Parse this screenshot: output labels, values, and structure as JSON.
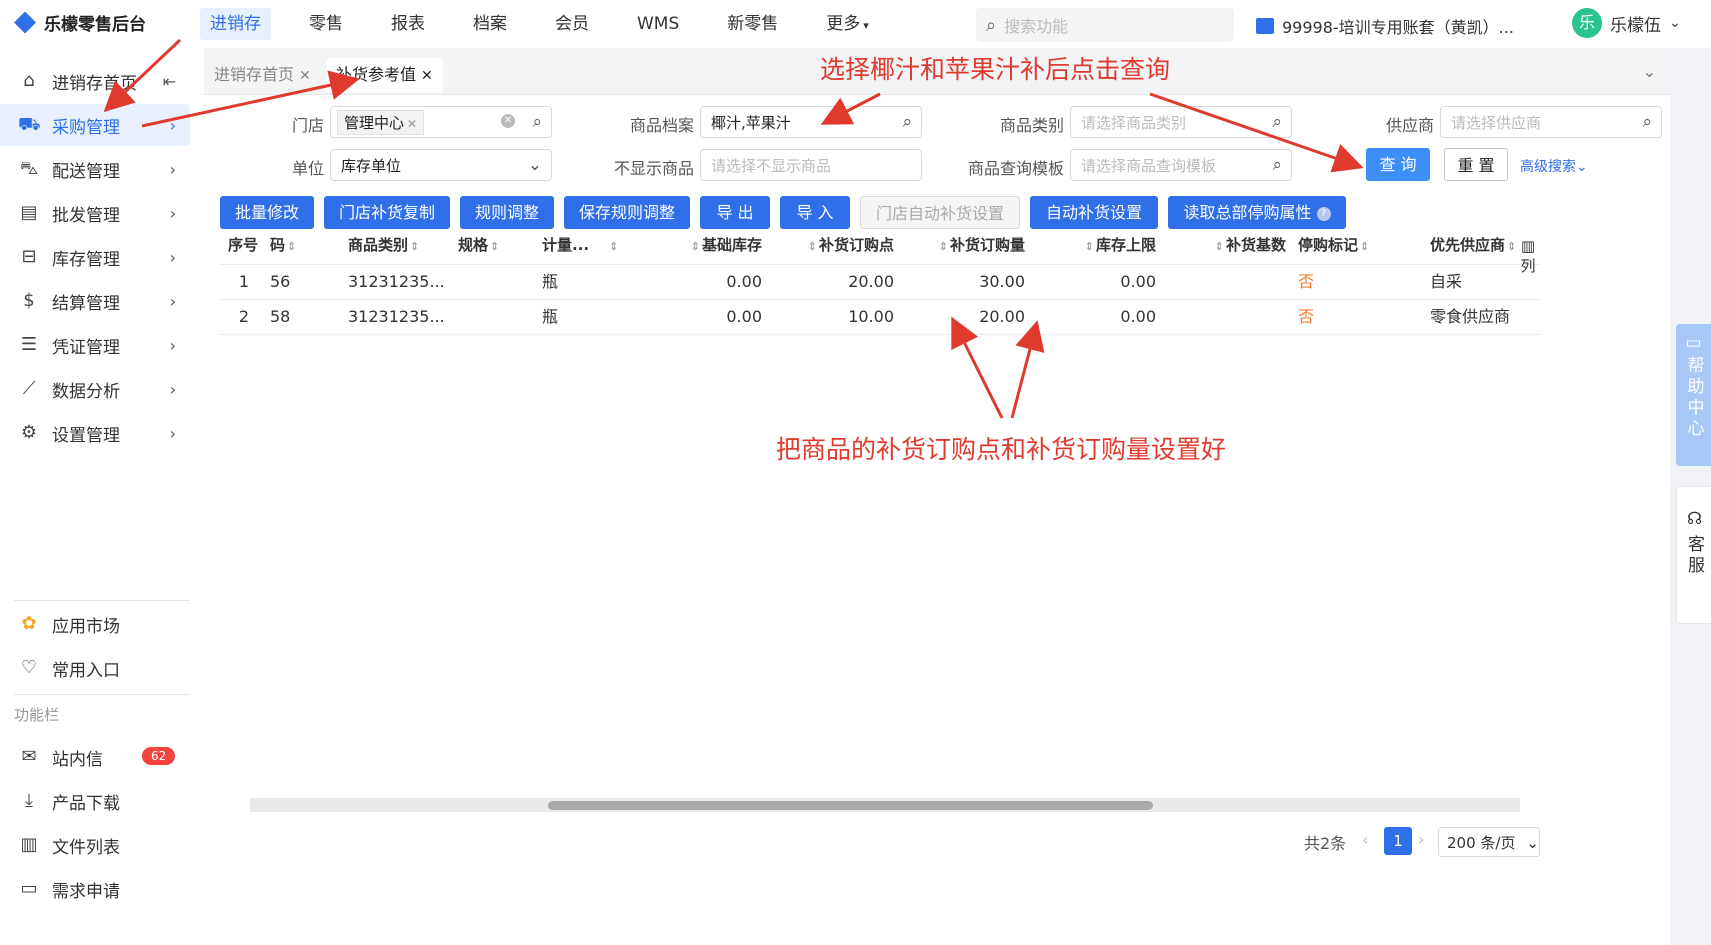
{
  "app": {
    "title": "乐檬零售后台"
  },
  "topnav": [
    "进销存",
    "零售",
    "报表",
    "档案",
    "会员",
    "WMS",
    "新零售",
    "更多"
  ],
  "search": {
    "placeholder": "搜索功能"
  },
  "account": {
    "label": "99998-培训专用账套（黄凯）..."
  },
  "user": {
    "avatar": "乐",
    "name": "乐檬伍"
  },
  "sidebar": {
    "items": [
      {
        "label": "进销存首页"
      },
      {
        "label": "采购管理"
      },
      {
        "label": "配送管理"
      },
      {
        "label": "批发管理"
      },
      {
        "label": "库存管理"
      },
      {
        "label": "结算管理"
      },
      {
        "label": "凭证管理"
      },
      {
        "label": "数据分析"
      },
      {
        "label": "设置管理"
      }
    ],
    "bottom": [
      {
        "label": "应用市场"
      },
      {
        "label": "常用入口"
      }
    ],
    "caption": "功能栏",
    "tools": [
      {
        "label": "站内信",
        "badge": "62"
      },
      {
        "label": "产品下载"
      },
      {
        "label": "文件列表"
      },
      {
        "label": "需求申请"
      }
    ]
  },
  "tabs": [
    "进销存首页",
    "补货参考值"
  ],
  "filters": {
    "store_label": "门店",
    "store_value": "管理中心",
    "goods_label": "商品档案",
    "goods_value": "椰汁,苹果汁",
    "category_label": "商品类别",
    "category_ph": "请选择商品类别",
    "supplier_label": "供应商",
    "supplier_ph": "请选择供应商",
    "unit_label": "单位",
    "unit_value": "库存单位",
    "hide_label": "不显示商品",
    "hide_ph": "请选择不显示商品",
    "template_label": "商品查询模板",
    "template_ph": "请选择商品查询模板",
    "query": "查 询",
    "reset": "重 置",
    "advanced": "高级搜索"
  },
  "toolbar": [
    "批量修改",
    "门店补货复制",
    "规则调整",
    "保存规则调整",
    "导 出",
    "导 入",
    "门店自动补货设置",
    "自动补货设置",
    "读取总部停购属性"
  ],
  "table": {
    "headers": [
      "序号",
      "码",
      "商品类别",
      "规格",
      "计量...",
      "基础库存",
      "补货订购点",
      "补货订购量",
      "库存上限",
      "补货基数",
      "停购标记",
      "优先供应商"
    ],
    "rows": [
      [
        "1",
        "56",
        "31231235...",
        "",
        "瓶",
        "0.00",
        "20.00",
        "30.00",
        "0.00",
        "",
        "否",
        "自采"
      ],
      [
        "2",
        "58",
        "31231235...",
        "",
        "瓶",
        "0.00",
        "10.00",
        "20.00",
        "0.00",
        "",
        "否",
        "零食供应商"
      ]
    ],
    "col_setting": "列"
  },
  "pagination": {
    "total": "共2条",
    "page": "1",
    "size": "200 条/页"
  },
  "help": {
    "label": "帮助中心",
    "service": "客服"
  },
  "annotations": {
    "top": "选择椰汁和苹果汁补后点击查询",
    "middle": "把商品的补货订购点和补货订购量设置好"
  },
  "colors": {
    "accent": "#2f6fe8",
    "annotation": "#e03a2f",
    "stop_flag": "#f07b2a"
  }
}
